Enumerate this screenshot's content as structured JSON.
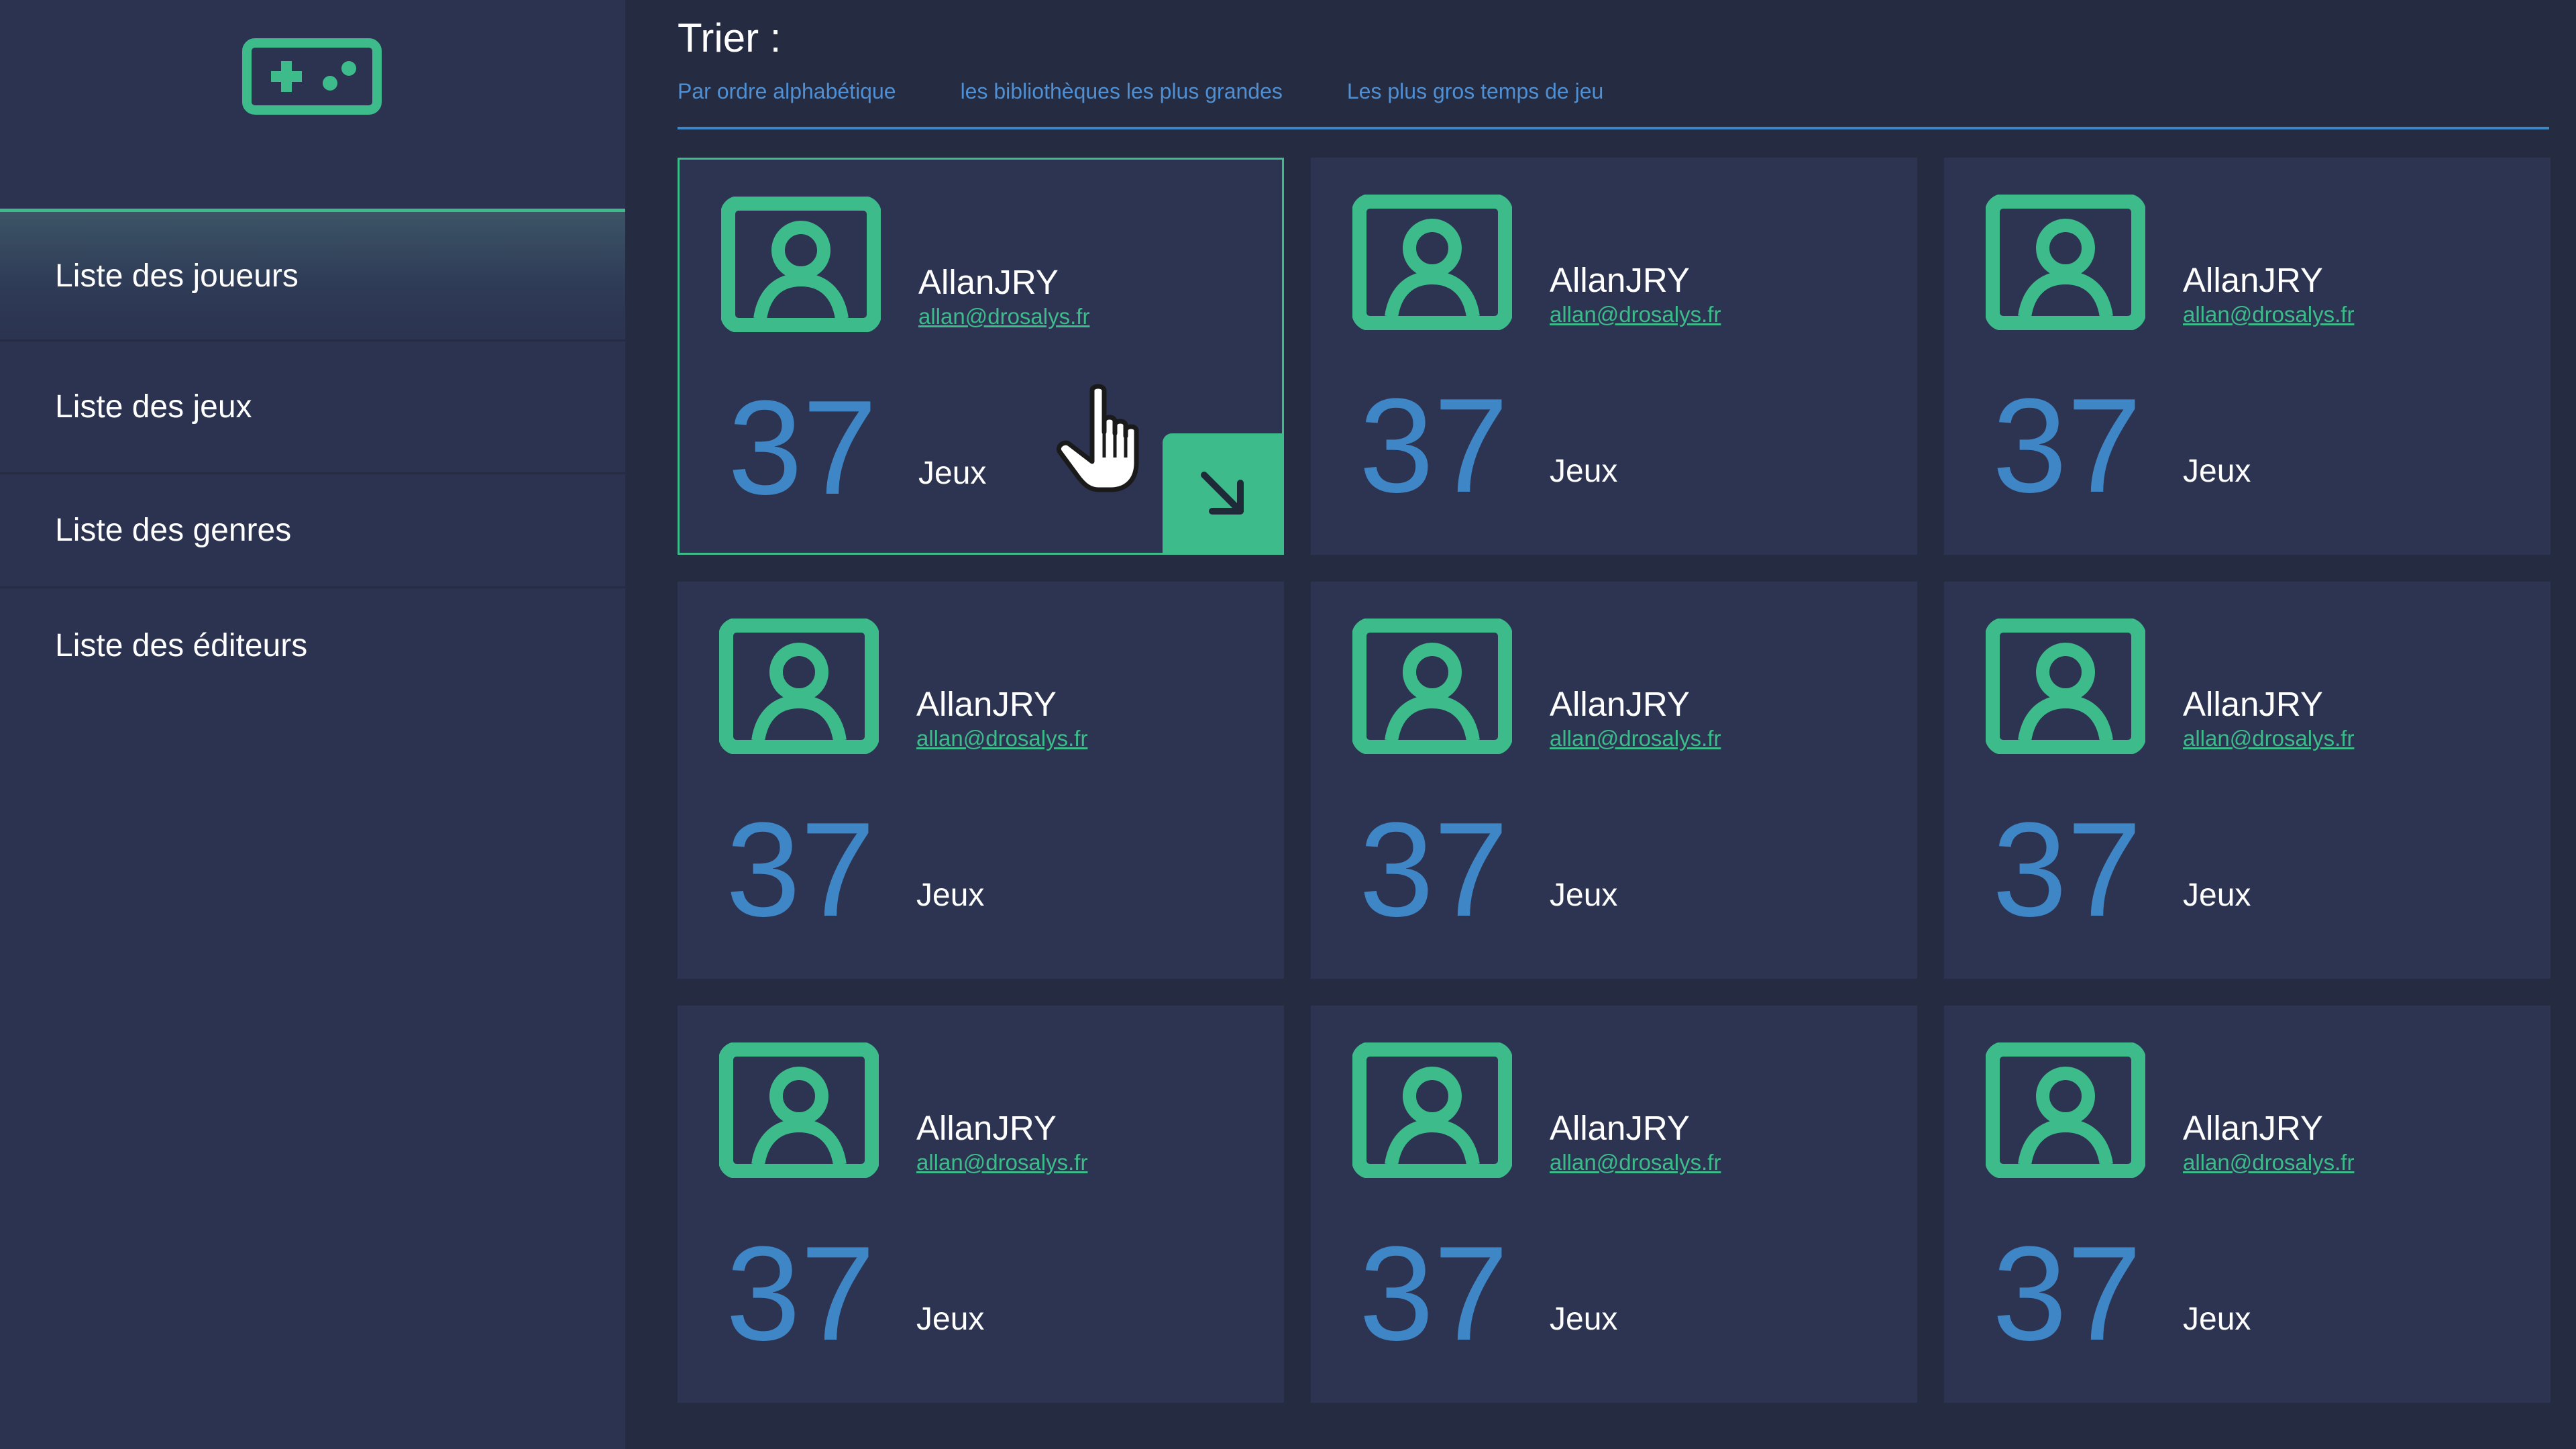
{
  "app": {
    "logo_icon": "gamepad-icon"
  },
  "sidebar": {
    "items": [
      {
        "label": "Liste des joueurs",
        "active": true
      },
      {
        "label": "Liste des jeux"
      },
      {
        "label": "Liste des genres"
      },
      {
        "label": "Liste des éditeurs"
      }
    ]
  },
  "sort": {
    "title": "Trier :",
    "options": [
      "Par ordre alphabétique",
      "les bibliothèques les plus grandes",
      "Les plus gros  temps de jeu"
    ]
  },
  "players": [
    {
      "name": "AllanJRY",
      "email": "allan@drosalys.fr",
      "count": "37",
      "unit": "Jeux",
      "avatar_icon": "user-portrait-icon",
      "hovered": true,
      "action_icon": "arrow-down-right-icon"
    },
    {
      "name": "AllanJRY",
      "email": "allan@drosalys.fr",
      "count": "37",
      "unit": "Jeux",
      "avatar_icon": "user-portrait-icon"
    },
    {
      "name": "AllanJRY",
      "email": "allan@drosalys.fr",
      "count": "37",
      "unit": "Jeux",
      "avatar_icon": "user-portrait-icon"
    },
    {
      "name": "AllanJRY",
      "email": "allan@drosalys.fr",
      "count": "37",
      "unit": "Jeux",
      "avatar_icon": "user-portrait-icon"
    },
    {
      "name": "AllanJRY",
      "email": "allan@drosalys.fr",
      "count": "37",
      "unit": "Jeux",
      "avatar_icon": "user-portrait-icon"
    },
    {
      "name": "AllanJRY",
      "email": "allan@drosalys.fr",
      "count": "37",
      "unit": "Jeux",
      "avatar_icon": "user-portrait-icon"
    },
    {
      "name": "AllanJRY",
      "email": "allan@drosalys.fr",
      "count": "37",
      "unit": "Jeux",
      "avatar_icon": "user-portrait-icon"
    },
    {
      "name": "AllanJRY",
      "email": "allan@drosalys.fr",
      "count": "37",
      "unit": "Jeux",
      "avatar_icon": "user-portrait-icon"
    },
    {
      "name": "AllanJRY",
      "email": "allan@drosalys.fr",
      "count": "37",
      "unit": "Jeux",
      "avatar_icon": "user-portrait-icon"
    }
  ],
  "colors": {
    "background": "#252b40",
    "sidebar": "#2b3350",
    "card": "#2c3452",
    "accent_green": "#3dbb8b",
    "accent_blue": "#3f86c6",
    "link_blue": "#4f8fd3"
  },
  "cursor_icon": "hand-pointer-icon"
}
